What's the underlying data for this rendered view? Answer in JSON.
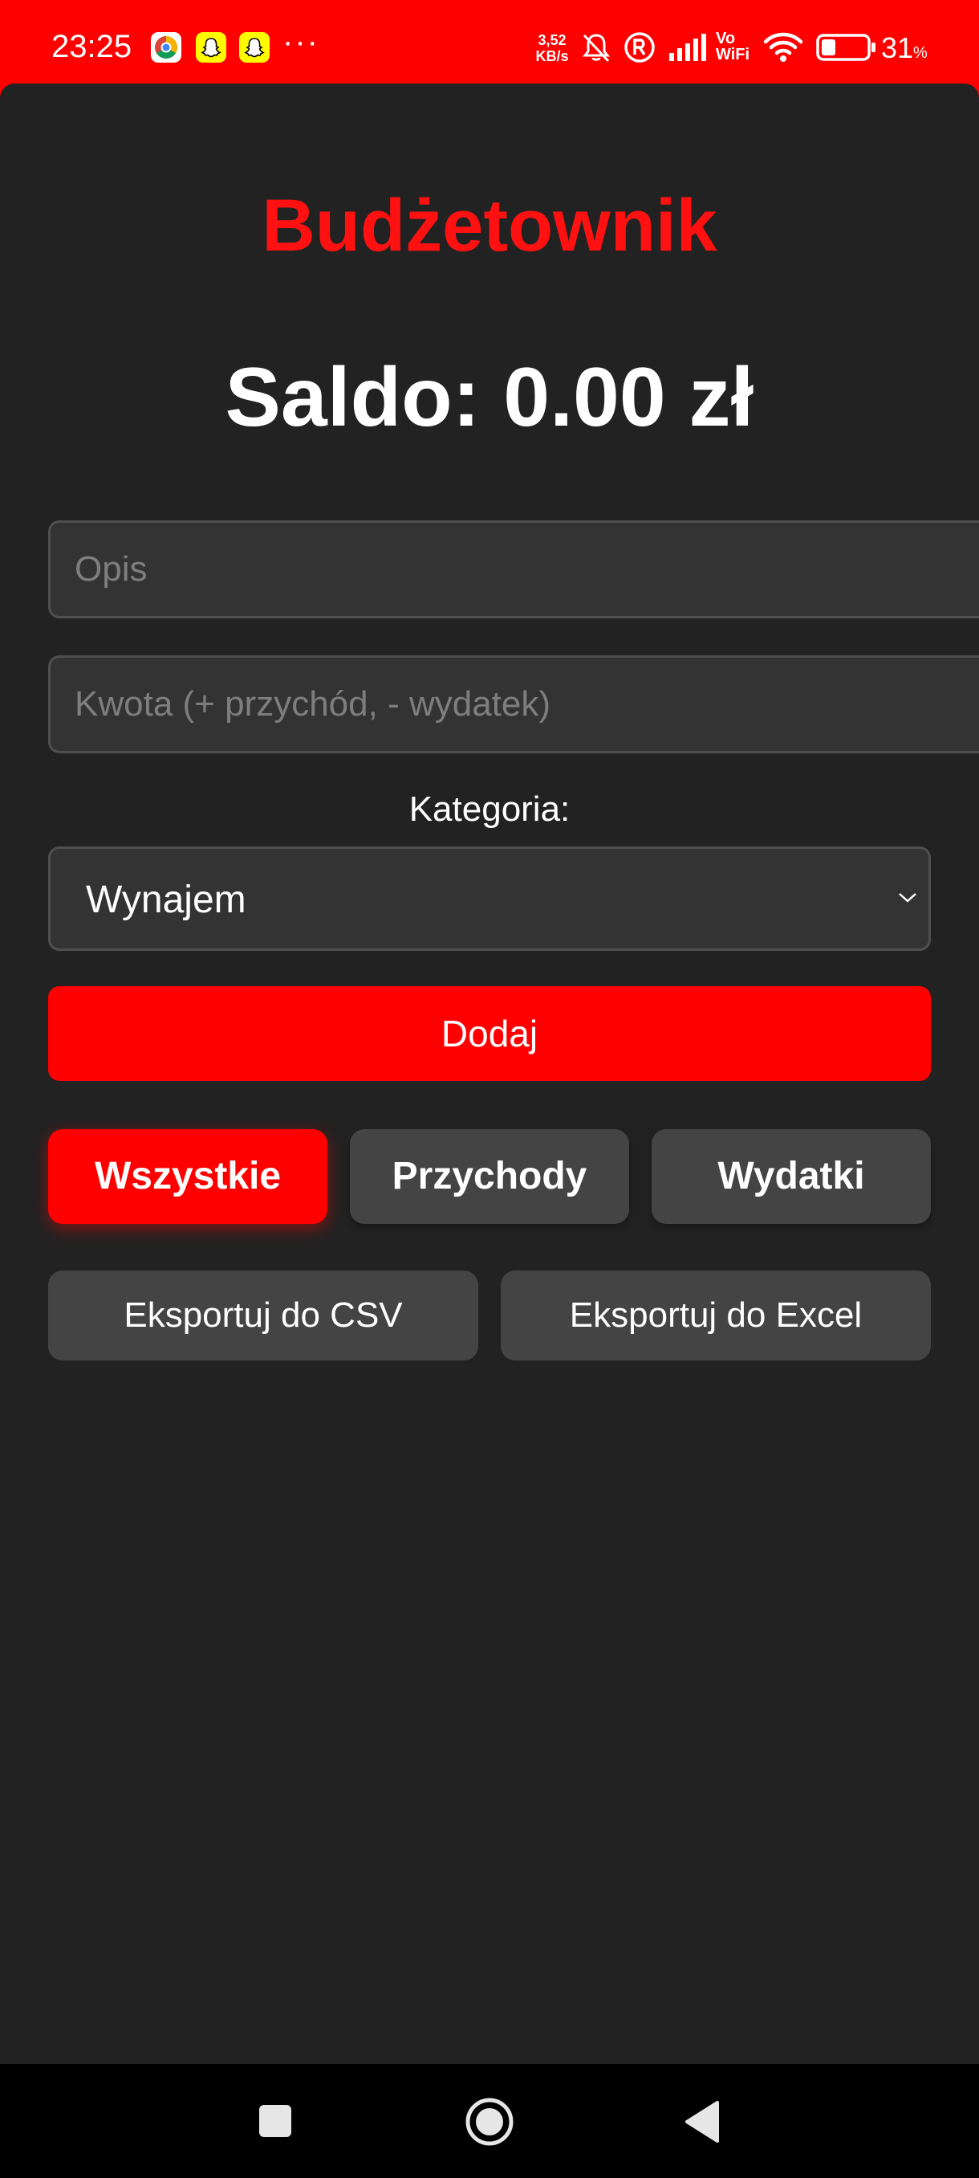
{
  "status_bar": {
    "time": "23:25",
    "more": "···",
    "network_speed_value": "3,52",
    "network_speed_unit": "KB/s",
    "vowifi_top": "Vo",
    "vowifi_bottom": "WiFi",
    "battery_percent": "31",
    "battery_percent_sign": "%",
    "battery_level": 0.31,
    "icons": [
      "chrome-icon",
      "snapchat-icon",
      "snapchat-icon",
      "bell-off-icon",
      "registered-icon",
      "signal-icon",
      "wifi-icon",
      "battery-icon"
    ]
  },
  "app": {
    "title": "Budżetownik",
    "balance_label": "Saldo:",
    "balance_value": "0.00 zł",
    "description_placeholder": "Opis",
    "amount_placeholder": "Kwota (+ przychód, - wydatek)",
    "category_label": "Kategoria:",
    "category_selected": "Wynajem",
    "add_button": "Dodaj",
    "filters": {
      "all": "Wszystkie",
      "income": "Przychody",
      "expenses": "Wydatki",
      "active": "all"
    },
    "export_csv": "Eksportuj do CSV",
    "export_excel": "Eksportuj do Excel"
  },
  "nav_bar": {
    "icons": [
      "recent-apps-icon",
      "home-icon",
      "back-icon"
    ]
  },
  "colors": {
    "accent": "#ff0000",
    "background": "#222222",
    "input_background": "#333333",
    "secondary_button": "#444444"
  }
}
